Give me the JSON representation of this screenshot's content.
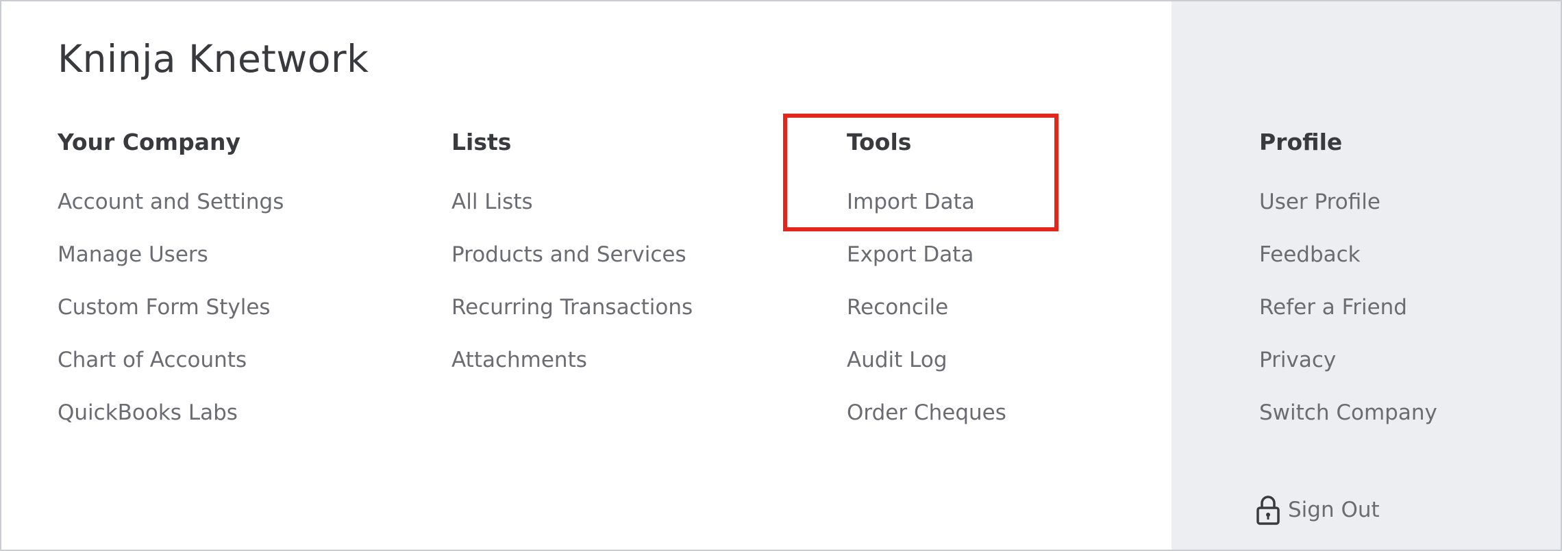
{
  "company_name": "Kninja Knetwork",
  "colors": {
    "highlight": "#e3261c",
    "panel_background": "#eceef1",
    "heading_text": "#393a3d",
    "item_text": "#6b6c72"
  },
  "columns": [
    {
      "heading": "Your Company",
      "items": [
        "Account and Settings",
        "Manage Users",
        "Custom Form Styles",
        "Chart of Accounts",
        "QuickBooks Labs"
      ]
    },
    {
      "heading": "Lists",
      "items": [
        "All Lists",
        "Products and Services",
        "Recurring Transactions",
        "Attachments"
      ]
    },
    {
      "heading": "Tools",
      "items": [
        "Import Data",
        "Export Data",
        "Reconcile",
        "Audit Log",
        "Order Cheques"
      ]
    },
    {
      "heading": "Profile",
      "items": [
        "User Profile",
        "Feedback",
        "Refer a Friend",
        "Privacy",
        "Switch Company"
      ]
    }
  ],
  "sign_out": {
    "label": "Sign Out",
    "icon": "lock-icon"
  }
}
